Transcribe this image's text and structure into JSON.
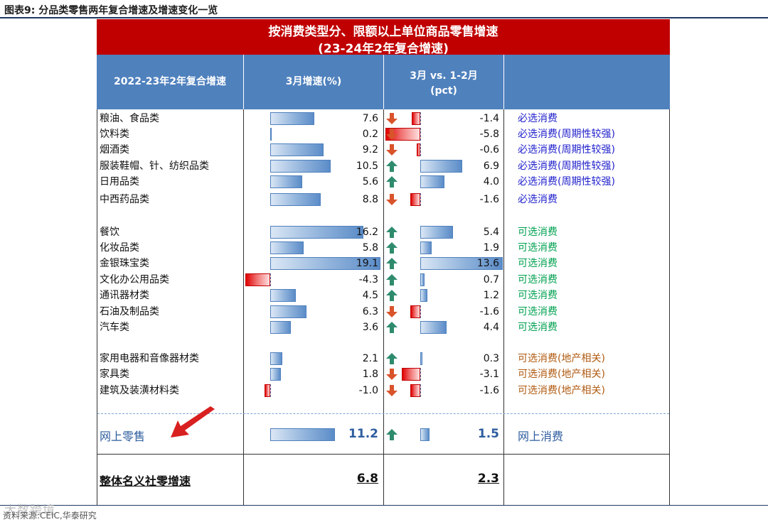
{
  "figure": {
    "title": "图表9:  分品类零售两年复合增速及增速变化一览",
    "source": "资料来源:CEIC,华泰研究",
    "watermark": "大数跨境"
  },
  "table": {
    "banner_line1": "按消费类型分、限额以上单位商品零售增速",
    "banner_line2": "(23-24年2年复合增速)",
    "header_col1": "2022-23年2年复合增速",
    "header_col2": "3月增速(%)",
    "header_col3_line1": "3月  vs.  1-2月",
    "header_col3_line2": "(pct)",
    "header_col4": ""
  },
  "chart_data": {
    "type": "table",
    "columns": [
      "2022-23年2年复合增速",
      "3月增速(%)",
      "3月 vs. 1-2月(pct)",
      ""
    ],
    "rows": [
      {
        "category": "粮油、食品类",
        "growth": "7.6",
        "change": "-1.4",
        "direction": "down",
        "type": "必选消费",
        "group": "necessity"
      },
      {
        "category": "饮料类",
        "growth": "0.2",
        "change": "-5.8",
        "direction": "down",
        "type": "必选消费(周期性较强)",
        "group": "necessity"
      },
      {
        "category": "烟酒类",
        "growth": "9.2",
        "change": "-0.6",
        "direction": "down",
        "type": "必选消费(周期性较强)",
        "group": "necessity"
      },
      {
        "category": "服装鞋帽、针、纺织品类",
        "growth": "10.5",
        "change": "6.9",
        "direction": "up",
        "type": "必选消费(周期性较强)",
        "group": "necessity"
      },
      {
        "category": "日用品类",
        "growth": "5.6",
        "change": "4.0",
        "direction": "up",
        "type": "必选消费(周期性较强)",
        "group": "necessity"
      },
      {
        "category": "中西药品类",
        "growth": "8.8",
        "change": "-1.6",
        "direction": "down",
        "type": "必选消费",
        "group": "necessity"
      },
      {
        "category": "餐饮",
        "growth": "16.2",
        "change": "5.4",
        "direction": "up",
        "type": "可选消费",
        "group": "optional"
      },
      {
        "category": "化妆品类",
        "growth": "5.8",
        "change": "1.9",
        "direction": "up",
        "type": "可选消费",
        "group": "optional"
      },
      {
        "category": "金银珠宝类",
        "growth": "19.1",
        "change": "13.6",
        "direction": "up",
        "type": "可选消费",
        "group": "optional"
      },
      {
        "category": "文化办公用品类",
        "growth": "-4.3",
        "change": "0.7",
        "direction": "up",
        "type": "可选消费",
        "group": "optional"
      },
      {
        "category": "通讯器材类",
        "growth": "4.5",
        "change": "1.2",
        "direction": "up",
        "type": "可选消费",
        "group": "optional"
      },
      {
        "category": "石油及制品类",
        "growth": "6.3",
        "change": "-1.6",
        "direction": "down",
        "type": "可选消费",
        "group": "optional"
      },
      {
        "category": "汽车类",
        "growth": "3.6",
        "change": "4.4",
        "direction": "up",
        "type": "可选消费",
        "group": "optional"
      },
      {
        "category": "家用电器和音像器材类",
        "growth": "2.1",
        "change": "0.3",
        "direction": "up",
        "type": "可选消费(地产相关)",
        "group": "property"
      },
      {
        "category": "家具类",
        "growth": "1.8",
        "change": "-3.1",
        "direction": "down",
        "type": "可选消费(地产相关)",
        "group": "property"
      },
      {
        "category": "建筑及装潢材料类",
        "growth": "-1.0",
        "change": "-1.6",
        "direction": "down",
        "type": "可选消费(地产相关)",
        "group": "property"
      }
    ],
    "online": {
      "category": "网上零售",
      "growth": "11.2",
      "change": "1.5",
      "direction": "up",
      "type": "网上消费"
    },
    "total": {
      "category": "整体名义社零增速",
      "growth": "6.8",
      "change": "2.3"
    },
    "colors": {
      "necessity": "#1f1fcc",
      "optional": "#00a050",
      "property": "#b05a10",
      "arrow_up": "#2e8b6e",
      "arrow_down": "#d9532b"
    }
  }
}
